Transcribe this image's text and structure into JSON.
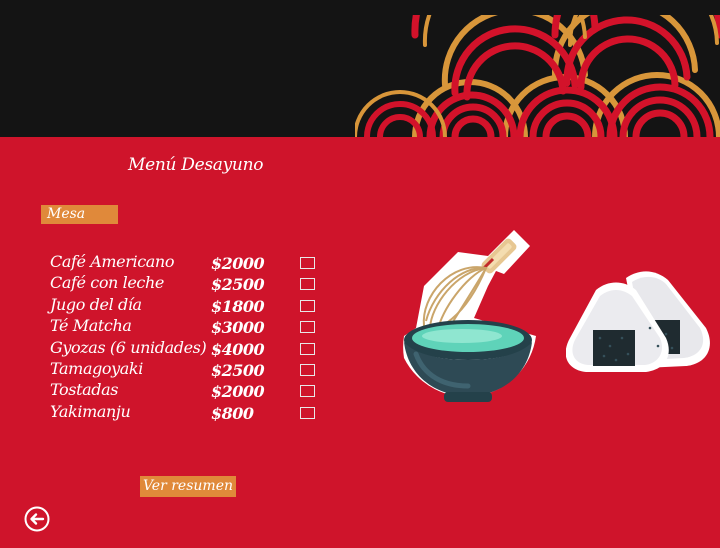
{
  "screen": {
    "title": "Menú Desayuno",
    "table_button_label": "Mesa",
    "summary_button_label": "Ver resumen"
  },
  "menu": {
    "items": [
      {
        "name": "Café Americano",
        "price": "$2000",
        "selected": false
      },
      {
        "name": "Café con leche",
        "price": "$2500",
        "selected": false
      },
      {
        "name": "Jugo del día",
        "price": "$1800",
        "selected": false
      },
      {
        "name": "Té Matcha",
        "price": "$3000",
        "selected": false
      },
      {
        "name": "Gyozas (6 unidades)",
        "price": "$4000",
        "selected": false
      },
      {
        "name": "Tamagoyaki",
        "price": "$2500",
        "selected": false
      },
      {
        "name": "Tostadas",
        "price": "$2000",
        "selected": false
      },
      {
        "name": "Yakimanju",
        "price": "$800",
        "selected": false
      }
    ]
  },
  "icons": {
    "back": "back-arrow-circle-icon",
    "header_art": "seigaiha-wave-pattern",
    "matcha_art": "matcha-bowl-whisk-illustration",
    "onigiri_art": "onigiri-rice-balls-illustration"
  },
  "colors": {
    "background": "#cf142b",
    "header": "#141414",
    "accent_button": "#e0893a",
    "wave_gold": "#d8963a",
    "wave_red": "#d3122a"
  }
}
